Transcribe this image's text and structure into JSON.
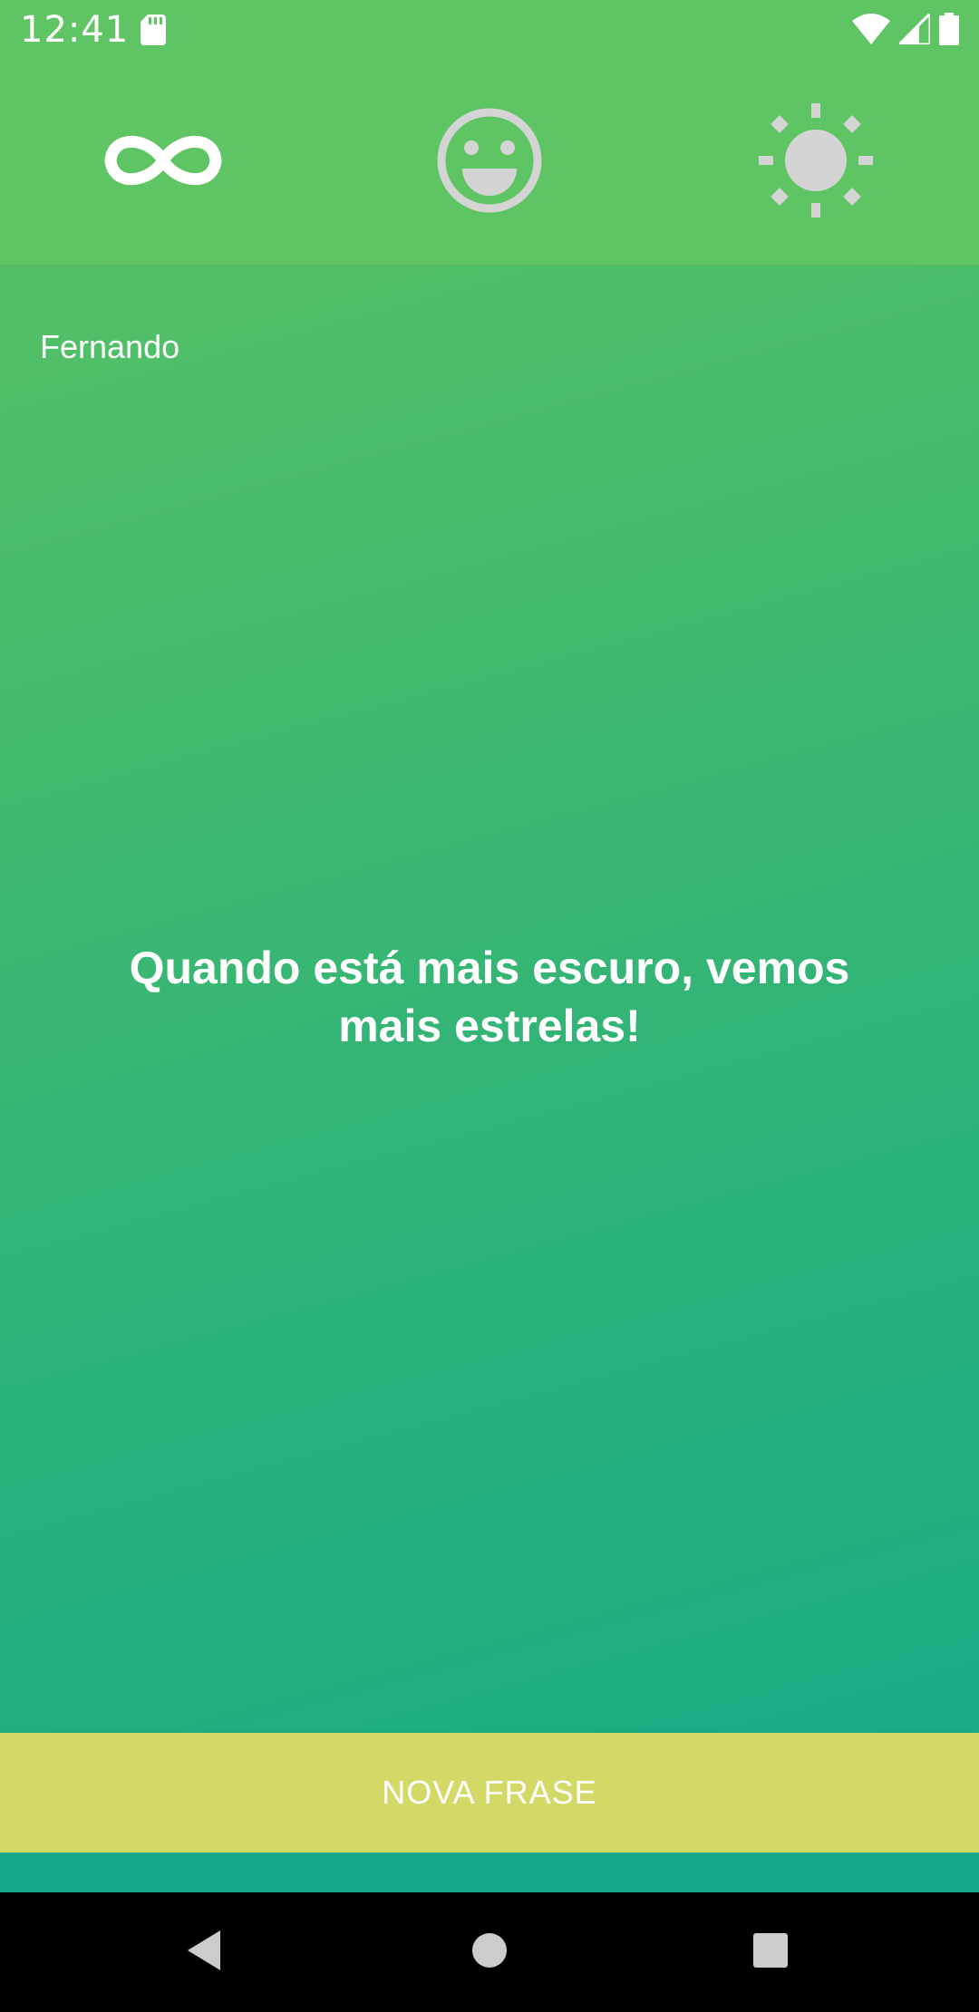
{
  "status_bar": {
    "time": "12:41",
    "icons": [
      "sd-card-icon",
      "wifi-icon",
      "signal-icon",
      "battery-icon"
    ]
  },
  "top_nav": {
    "tabs": [
      {
        "name": "infinity",
        "icon": "infinity-icon",
        "active": true
      },
      {
        "name": "smiley",
        "icon": "smiley-icon",
        "active": false
      },
      {
        "name": "sun",
        "icon": "sun-icon",
        "active": false
      }
    ]
  },
  "main": {
    "user_name": "Fernando",
    "phrase": "Quando está mais escuro, vemos mais estrelas!"
  },
  "actions": {
    "new_phrase_label": "NOVA FRASE"
  },
  "system_nav": {
    "buttons": [
      "back-icon",
      "home-icon",
      "recents-icon"
    ]
  },
  "colors": {
    "header": "#5fc463",
    "gradient_top": "#5dc462",
    "gradient_bottom": "#13a98a",
    "button": "#d3d866",
    "inactive_icon": "#d4d4d4"
  }
}
